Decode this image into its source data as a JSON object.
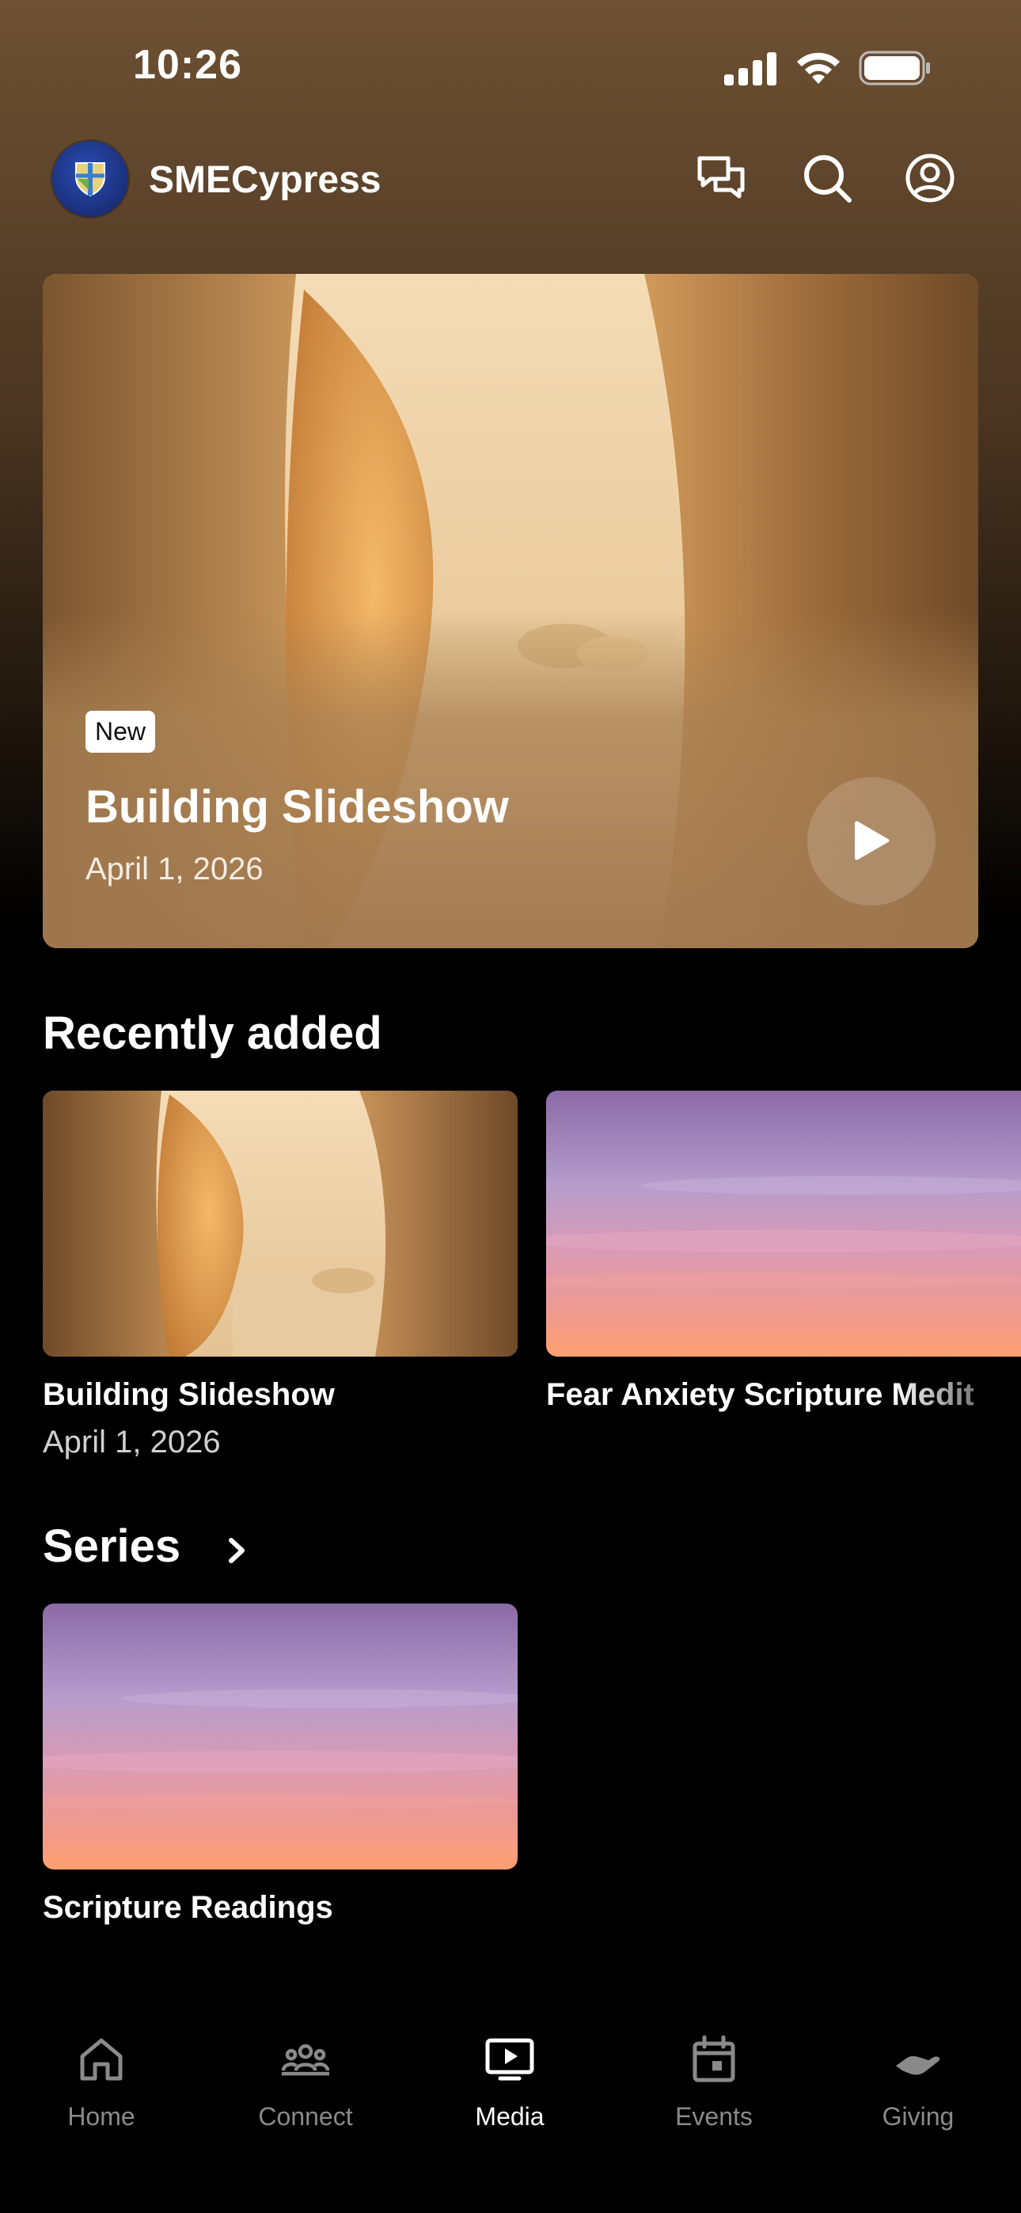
{
  "status_bar": {
    "time": "10:26",
    "icons": [
      "cellular-signal-icon",
      "wifi-icon",
      "battery-icon"
    ]
  },
  "header": {
    "app_name": "SMECypress",
    "icons": [
      "chat-bubbles-icon",
      "search-icon",
      "profile-icon"
    ]
  },
  "featured": {
    "badge": "New",
    "title": "Building Slideshow",
    "date": "April 1, 2026",
    "action_icon": "play-icon"
  },
  "recently_added": {
    "title": "Recently added",
    "items": [
      {
        "title": "Building Slideshow",
        "date": "April 1, 2026"
      },
      {
        "title": "Fear Anxiety Scripture Medit"
      }
    ]
  },
  "series": {
    "title": "Series",
    "items": [
      {
        "title": "Scripture Readings"
      }
    ]
  },
  "tabs": [
    {
      "label": "Home",
      "icon": "home-icon",
      "active": false
    },
    {
      "label": "Connect",
      "icon": "people-icon",
      "active": false
    },
    {
      "label": "Media",
      "icon": "tv-play-icon",
      "active": true
    },
    {
      "label": "Events",
      "icon": "calendar-icon",
      "active": false
    },
    {
      "label": "Giving",
      "icon": "giving-hand-icon",
      "active": false
    }
  ],
  "colors": {
    "background": "#000000",
    "active_tab": "#ffffff",
    "inactive_tab": "#8a8a8a",
    "badge_bg": "#ffffff"
  }
}
